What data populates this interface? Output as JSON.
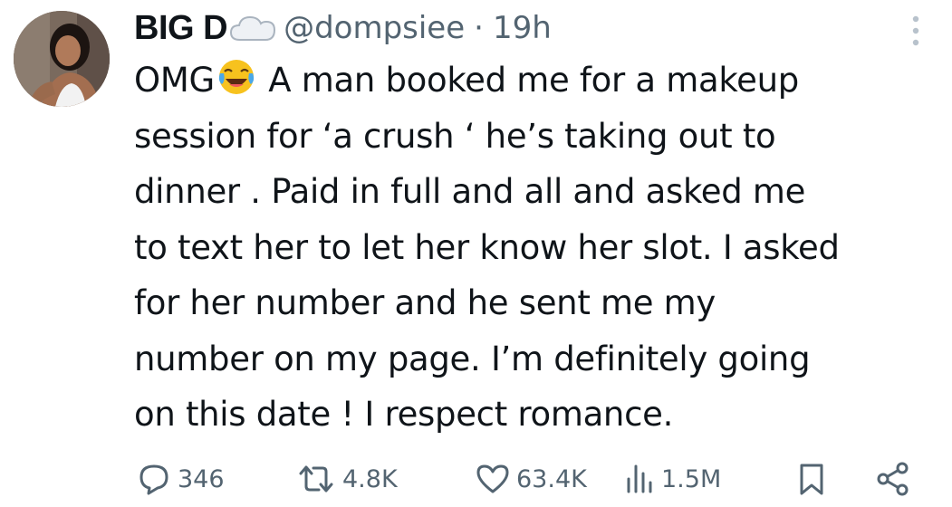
{
  "tweet": {
    "display_name": "BIG D",
    "name_emoji": "cloud-icon",
    "handle": "@dompsiee",
    "separator": "·",
    "time": "19h",
    "lines": [
      {
        "before": "OMG",
        "emoji": "tears-of-joy-emoji",
        "after": " A man booked me for a makeup"
      },
      {
        "text": "session for ‘a crush ‘ he’s taking out to"
      },
      {
        "text": "dinner . Paid in full and all and asked me"
      },
      {
        "text": "to text her to let her know her slot. I asked"
      },
      {
        "text": "for her number and he sent me my"
      },
      {
        "text": "number on my page. I’m definitely going"
      },
      {
        "text": "on this date ! I respect romance."
      }
    ]
  },
  "actions": {
    "replies": "346",
    "reposts": "4.8K",
    "likes": "63.4K",
    "views": "1.5M"
  },
  "colors": {
    "text_primary": "#0f1419",
    "text_secondary": "#536471",
    "background": "#ffffff"
  }
}
